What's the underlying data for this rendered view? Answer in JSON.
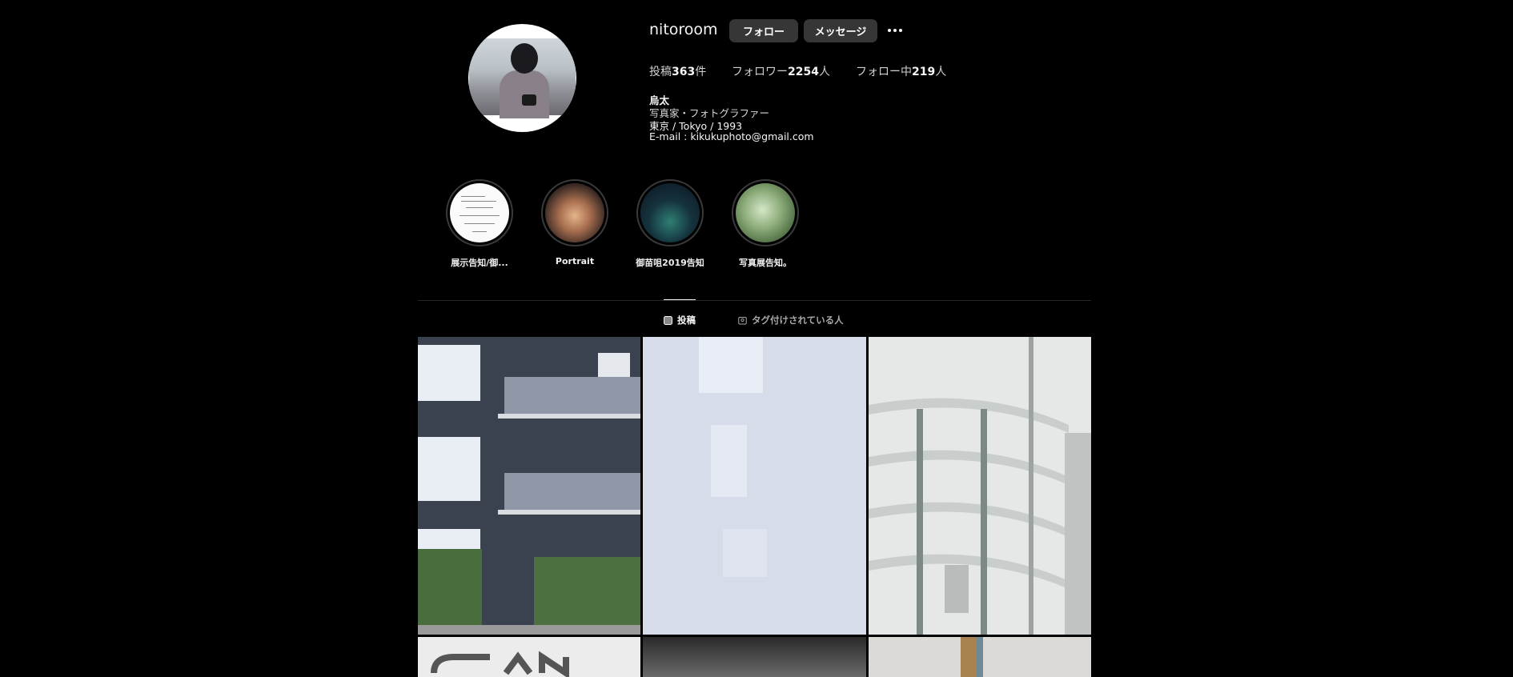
{
  "profile": {
    "username": "nitoroom",
    "follow_label": "フォロー",
    "message_label": "メッセージ",
    "more_icon": "more-horizontal-icon"
  },
  "stats": {
    "posts_prefix": "投稿",
    "posts_count": "363",
    "posts_suffix": "件",
    "followers_prefix": "フォロワー",
    "followers_count": "2254",
    "followers_suffix": "人",
    "following_prefix": "フォロー中",
    "following_count": "219",
    "following_suffix": "人"
  },
  "bio": {
    "name": "烏太",
    "line1": "写真家・フォトグラファー",
    "line2": "東京 / Tokyo / 1993",
    "line3": "E-mail : kikukuphoto@gmail.com"
  },
  "highlights": [
    {
      "label": "展示告知/御..."
    },
    {
      "label": "Portrait"
    },
    {
      "label": "御苗咀2019告知"
    },
    {
      "label": "写真展告知。"
    }
  ],
  "tabs": {
    "posts_label": "投稿",
    "posts_icon": "grid-icon",
    "tagged_label": "タグ付けされている人",
    "tagged_icon": "tagged-icon"
  },
  "colors": {
    "background": "#000000",
    "button": "#363636",
    "text": "#f5f5f5",
    "muted": "#a8a8a8"
  }
}
